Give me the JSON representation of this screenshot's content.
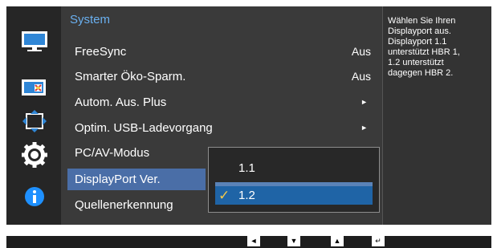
{
  "menu": {
    "title": "System",
    "items": [
      {
        "label": "FreeSync",
        "value": "Aus",
        "arrow": ""
      },
      {
        "label": "Smarter Öko-Sparm.",
        "value": "Aus",
        "arrow": ""
      },
      {
        "label": "Autom. Aus. Plus",
        "value": "",
        "arrow": "►"
      },
      {
        "label": "Optim. USB-Ladevorgang",
        "value": "",
        "arrow": "►"
      },
      {
        "label": "PC/AV-Modus",
        "value": "",
        "arrow": ""
      },
      {
        "label": "DisplayPort Ver.",
        "value": "",
        "arrow": ""
      },
      {
        "label": "Quellenerkennung",
        "value": "",
        "arrow": ""
      }
    ],
    "selected_item": "DisplayPort Ver."
  },
  "submenu": {
    "options": [
      {
        "label": "1.1",
        "selected": false
      },
      {
        "label": "1.2",
        "selected": true,
        "check": "✓"
      }
    ]
  },
  "sidebar_icons": [
    "picture-icon",
    "color-icon",
    "size-position-icon",
    "system-gear-icon",
    "information-icon"
  ],
  "help_text": "Wählen Sie Ihren\nDisplayport aus.\nDisplayport 1.1\nunterstützt HBR 1,\n1.2 unterstützt\ndagegen HBR 2.",
  "nav_keys": [
    {
      "name": "left-key",
      "glyph": "◄"
    },
    {
      "name": "down-key",
      "glyph": "▼"
    },
    {
      "name": "up-key",
      "glyph": "▲"
    },
    {
      "name": "enter-key",
      "glyph": "↵"
    }
  ],
  "colors": {
    "title_blue": "#6ab0f0",
    "highlight_blue": "#4a6ea7",
    "submenu_selected": "#1f64a6",
    "check_yellow": "#f2c94c",
    "info_blue": "#1e90ff"
  }
}
